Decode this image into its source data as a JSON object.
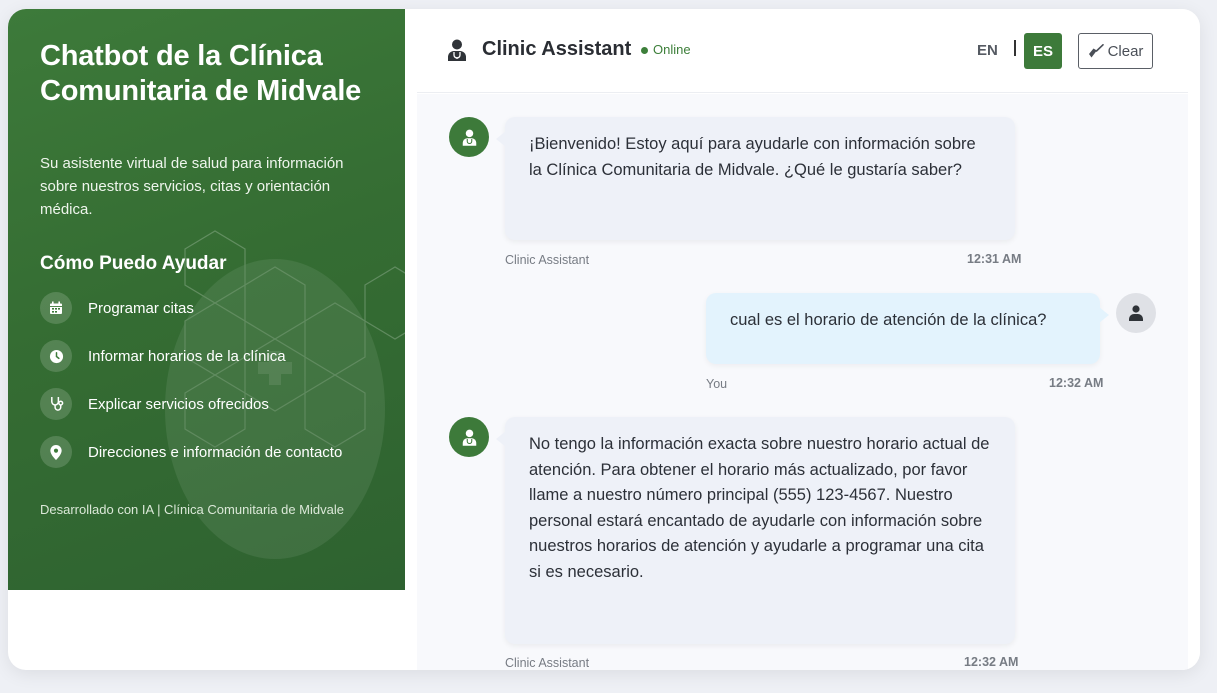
{
  "sidebar": {
    "title": "Chatbot de la Clínica Comunitaria de Midvale",
    "description": "Su asistente virtual de salud para información sobre nuestros servicios, citas y orientación médica.",
    "help_title": "Cómo Puedo Ayudar",
    "items": [
      {
        "icon": "calendar-icon",
        "label": "Programar citas"
      },
      {
        "icon": "clock-icon",
        "label": "Informar horarios de la clínica"
      },
      {
        "icon": "stethoscope-icon",
        "label": "Explicar servicios ofrecidos"
      },
      {
        "icon": "location-pin-icon",
        "label": "Direcciones e información de contacto"
      }
    ],
    "footer": "Desarrollado con IA | Clínica Comunitaria de Midvale"
  },
  "header": {
    "title": "Clinic Assistant",
    "status": "Online",
    "lang_en": "EN",
    "lang_es": "ES",
    "clear_label": "Clear"
  },
  "messages": [
    {
      "sender": "bot",
      "name": "Clinic Assistant",
      "time": "12:31 AM",
      "text": "¡Bienvenido! Estoy aquí para ayudarle con información sobre la Clínica Comunitaria de Midvale. ¿Qué le gustaría saber?"
    },
    {
      "sender": "user",
      "name": "You",
      "time": "12:32 AM",
      "text": "cual es el horario de atención de la clínica?"
    },
    {
      "sender": "bot",
      "name": "Clinic Assistant",
      "time": "12:32 AM",
      "text": "No tengo la información exacta sobre nuestro horario actual de atención. Para obtener el horario más actualizado, por favor llame a nuestro número principal (555) 123-4567. Nuestro personal estará encantado de ayudarle con información sobre nuestros horarios de atención y ayudarle a programar una cita si es necesario."
    }
  ],
  "colors": {
    "brand_green": "#3d7a3a",
    "bot_bubble": "#eef1f8",
    "user_bubble": "#e3f3fd"
  }
}
